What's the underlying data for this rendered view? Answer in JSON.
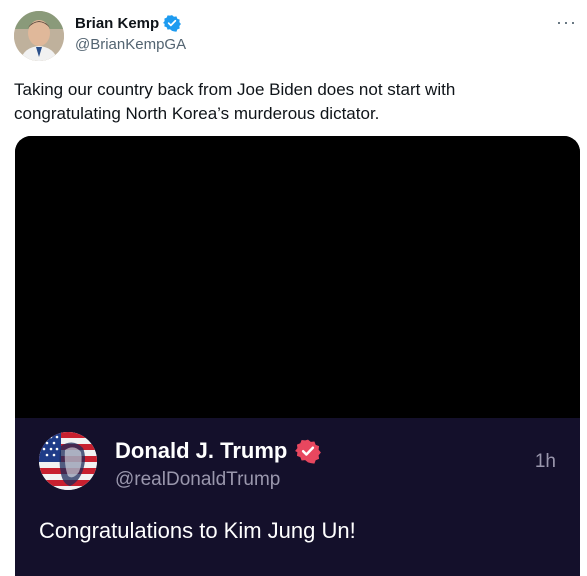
{
  "tweet": {
    "author_name": "Brian Kemp",
    "author_handle": "@BrianKempGA",
    "more_label": "···",
    "text": "Taking our country back from Joe Biden does not start with congratulating North Korea’s murderous dictator.",
    "verified_color": "#1d9bf0"
  },
  "quoted_post": {
    "author_name": "Donald J. Trump",
    "author_handle": "@realDonaldTrump",
    "time": "1h",
    "text": "Congratulations to Kim Jung Un!",
    "verified_color": "#e8475f",
    "background_color": "#14102b"
  }
}
